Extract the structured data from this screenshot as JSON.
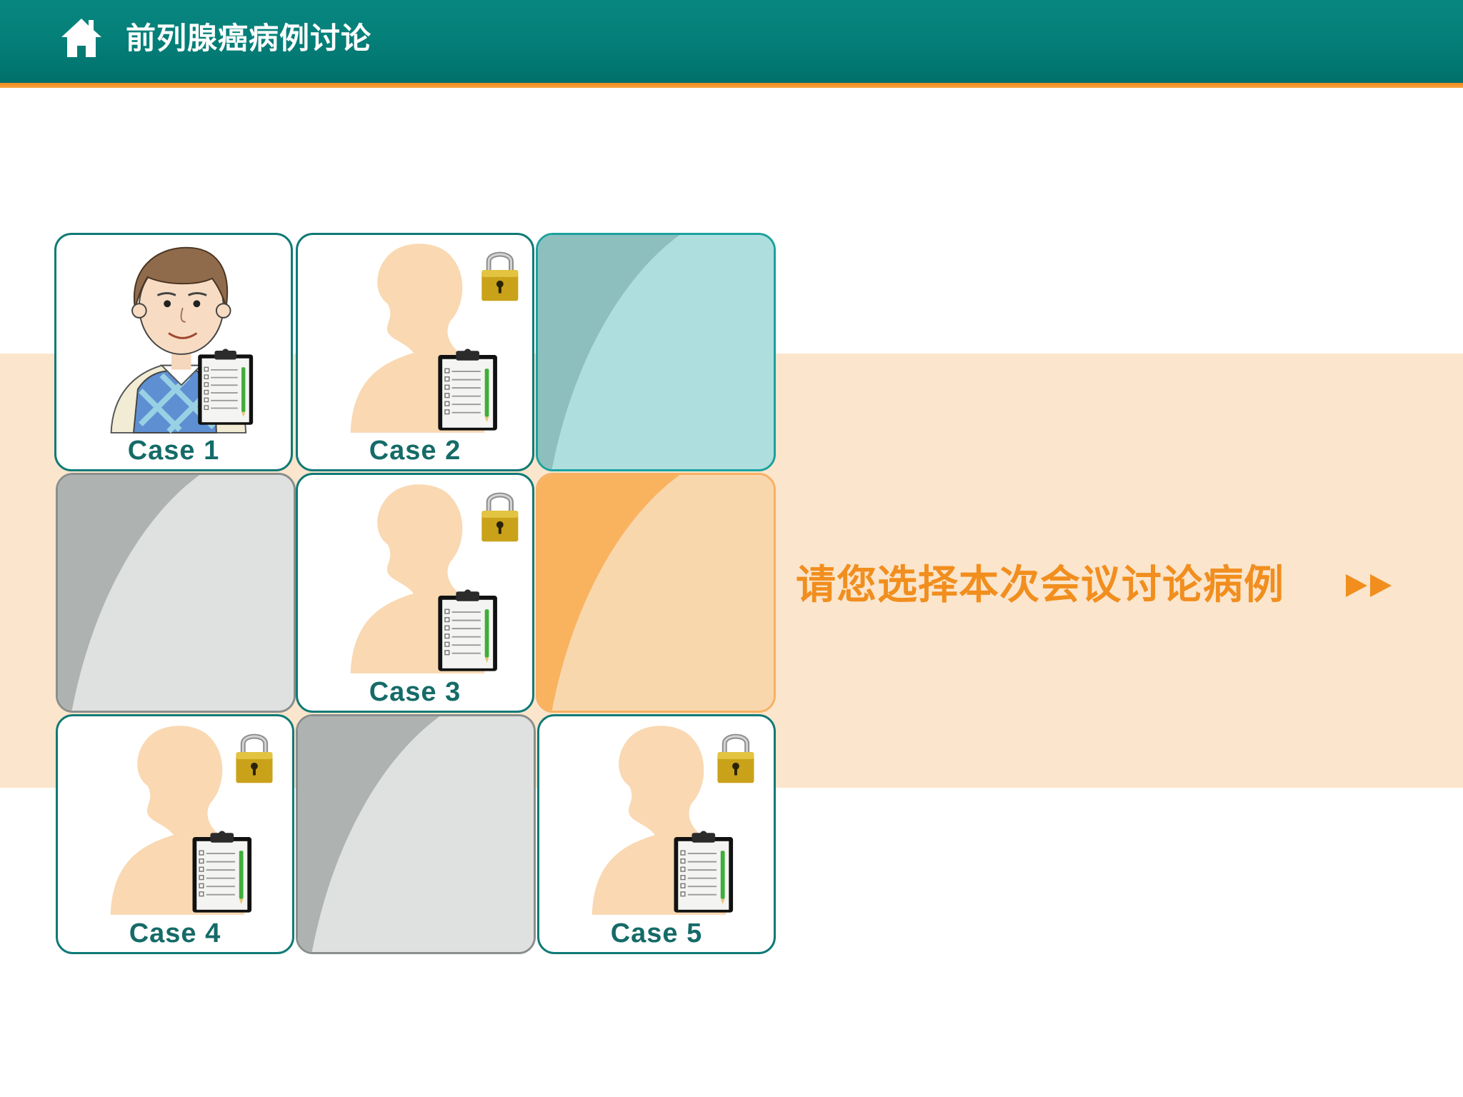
{
  "header": {
    "title": "前列腺癌病例讨论",
    "home_icon": "home-icon"
  },
  "colors": {
    "header_teal": "#058079",
    "accent_orange": "#f18e1e",
    "band_peach": "#fbe5cc",
    "case_border": "#0f7a76",
    "silhouette": "#f9d8b2"
  },
  "cases": [
    {
      "label": "Case 1",
      "locked": false,
      "avatar": "patient-avatar-icon"
    },
    {
      "label": "Case 2",
      "locked": true,
      "avatar": "silhouette-icon"
    },
    {
      "label": "Case 3",
      "locked": true,
      "avatar": "silhouette-icon"
    },
    {
      "label": "Case 4",
      "locked": true,
      "avatar": "silhouette-icon"
    },
    {
      "label": "Case 5",
      "locked": true,
      "avatar": "silhouette-icon"
    }
  ],
  "prompt": {
    "text": "请您选择本次会议讨论病例",
    "arrow_icon": "fast-forward-icon"
  }
}
